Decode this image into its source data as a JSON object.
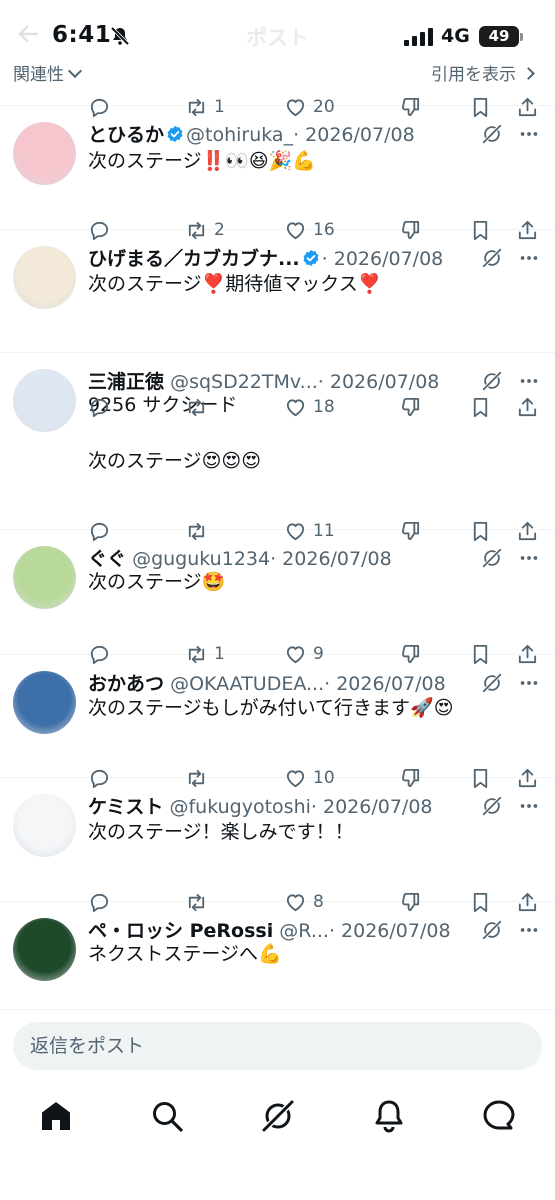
{
  "status_bar": {
    "time": "6:41",
    "network": "4G",
    "battery": "49"
  },
  "header_ghost": {
    "title": "ポスト"
  },
  "sort": {
    "left_label": "関連性",
    "right_label": "引用を表示"
  },
  "icons": {
    "reply": "reply-icon",
    "repost": "repost-icon",
    "like": "heart-icon",
    "dislike": "thumbs-down-icon",
    "bookmark": "bookmark-icon",
    "share": "share-icon",
    "grok": "grok-icon",
    "more": "more-icon"
  },
  "colors": {
    "verified": "#1d9bf0",
    "text": "#0f1419",
    "secondary": "#536471",
    "reply_bg": "#eff3f4"
  },
  "posts": [
    {
      "name": "とひるか",
      "handle": "@tohiruka_",
      "date": "· 2026/07/08",
      "text": "次のステージ‼️👀😆🎉💪",
      "reposts": "1",
      "likes": "20",
      "verified": true
    },
    {
      "name": "ひげまる／カブカブナ...",
      "handle": "",
      "date": "· 2026/07/08",
      "text": "次のステージ❣️期待値マックス❣️",
      "reposts": "2",
      "likes": "16",
      "verified": true
    },
    {
      "name": "三浦正徳",
      "handle": "@sqSD22TMv...",
      "date": "· 2026/07/08",
      "text": "9256 サクシード\n\n次のステージ😍😍😍",
      "reposts": "",
      "likes": "18",
      "verified": false
    },
    {
      "name": "ぐぐ",
      "handle": "@guguku1234",
      "date": "· 2026/07/08",
      "text": "次のステージ🤩",
      "reposts": "",
      "likes": "11",
      "verified": false
    },
    {
      "name": "おかあつ",
      "handle": "@OKAATUDEA...",
      "date": "· 2026/07/08",
      "text": "次のステージもしがみ付いて行きます🚀😍",
      "reposts": "1",
      "likes": "9",
      "verified": false
    },
    {
      "name": "ケミスト",
      "handle": "@fukugyotoshi",
      "date": "· 2026/07/08",
      "text": "次のステージ！楽しみです！！",
      "reposts": "",
      "likes": "10",
      "verified": false
    },
    {
      "name": "ペ・ロッシ PeRossi",
      "handle": "@R...",
      "date": "· 2026/07/08",
      "text": "ネクストステージへ💪",
      "reposts": "",
      "likes": "8",
      "verified": false
    }
  ],
  "reply_bar": {
    "placeholder": "返信をポスト"
  },
  "tabs": [
    "home-icon",
    "search-icon",
    "grok-icon",
    "notifications-icon",
    "messages-icon"
  ]
}
